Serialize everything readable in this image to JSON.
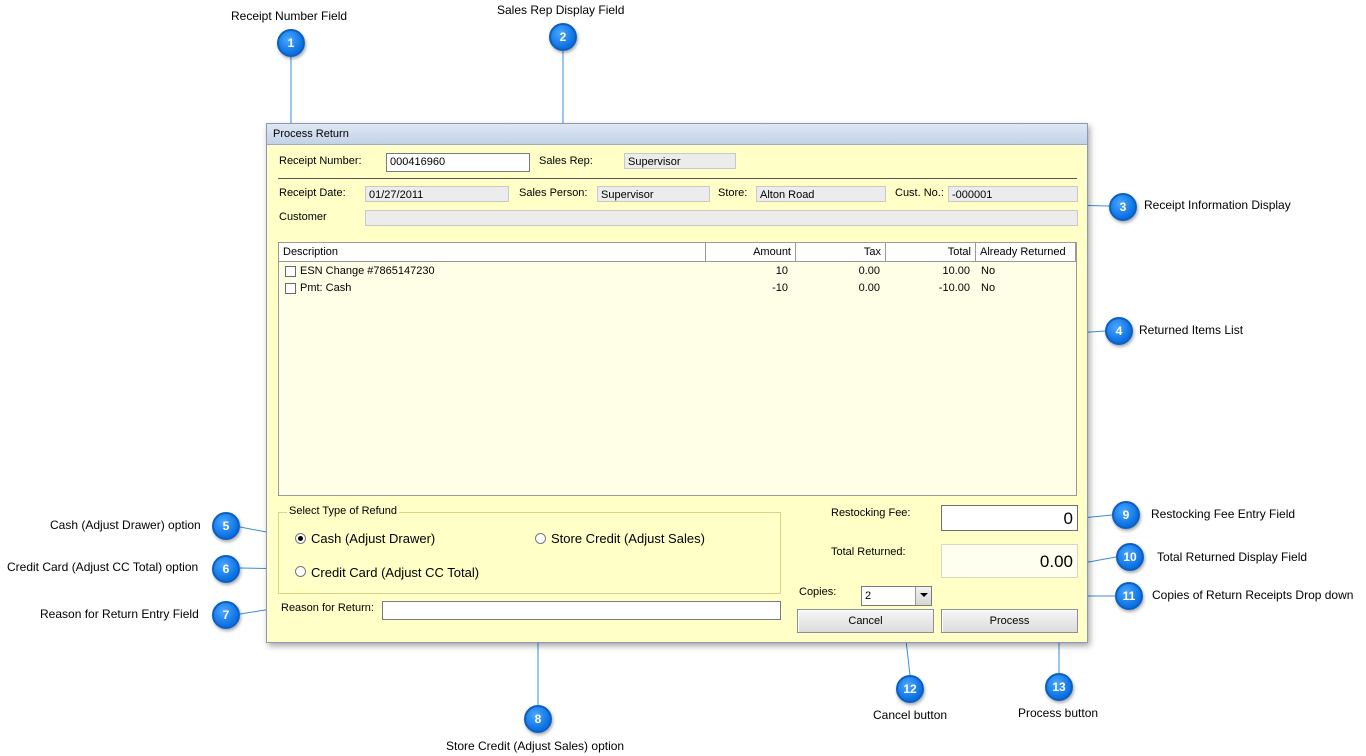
{
  "callouts": [
    {
      "num": "1",
      "label": "Receipt Number Field"
    },
    {
      "num": "2",
      "label": "Sales Rep Display Field"
    },
    {
      "num": "3",
      "label": "Receipt Information Display"
    },
    {
      "num": "4",
      "label": "Returned Items List"
    },
    {
      "num": "5",
      "label": "Cash (Adjust Drawer) option"
    },
    {
      "num": "6",
      "label": "Credit Card (Adjust CC Total) option"
    },
    {
      "num": "7",
      "label": "Reason for Return Entry Field"
    },
    {
      "num": "8",
      "label": "Store Credit (Adjust Sales) option"
    },
    {
      "num": "9",
      "label": "Restocking Fee Entry Field"
    },
    {
      "num": "10",
      "label": "Total Returned Display Field"
    },
    {
      "num": "11",
      "label": "Copies of Return Receipts Drop down"
    },
    {
      "num": "12",
      "label": "Cancel button"
    },
    {
      "num": "13",
      "label": "Process button"
    }
  ],
  "window": {
    "title": "Process Return",
    "receipt_number_label": "Receipt Number:",
    "receipt_number_value": "000416960",
    "sales_rep_label": "Sales Rep:",
    "sales_rep_value": "Supervisor",
    "receipt_date_label": "Receipt Date:",
    "receipt_date_value": "01/27/2011",
    "sales_person_label": "Sales Person:",
    "sales_person_value": "Supervisor",
    "store_label": "Store:",
    "store_value": "Alton Road",
    "cust_no_label": "Cust. No.:",
    "cust_no_value": "-000001",
    "customer_label": "Customer",
    "customer_value": ""
  },
  "items": {
    "columns": [
      "Description",
      "Amount",
      "Tax",
      "Total",
      "Already Returned"
    ],
    "rows": [
      {
        "description": "ESN Change #7865147230",
        "amount": "10",
        "tax": "0.00",
        "total": "10.00",
        "returned": "No",
        "checked": false
      },
      {
        "description": "Pmt: Cash",
        "amount": "-10",
        "tax": "0.00",
        "total": "-10.00",
        "returned": "No",
        "checked": false
      }
    ]
  },
  "refund": {
    "group_title": "Select Type of Refund",
    "options": [
      {
        "label": "Cash (Adjust Drawer)",
        "selected": true
      },
      {
        "label": "Credit Card (Adjust CC Total)",
        "selected": false
      },
      {
        "label": "Store Credit (Adjust Sales)",
        "selected": false
      }
    ]
  },
  "reason": {
    "label": "Reason for Return:",
    "value": ""
  },
  "restocking": {
    "label": "Restocking Fee:",
    "value": "0"
  },
  "total_returned": {
    "label": "Total Returned:",
    "value": "0.00"
  },
  "copies": {
    "label": "Copies:",
    "value": "2"
  },
  "buttons": {
    "cancel": "Cancel",
    "process": "Process"
  }
}
